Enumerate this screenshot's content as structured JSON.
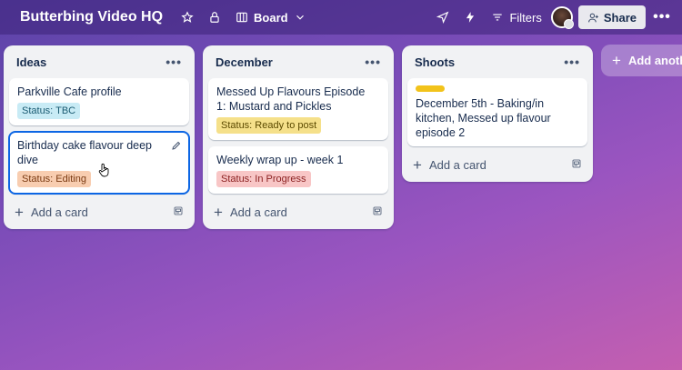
{
  "board": {
    "title": "Butterbing Video HQ",
    "view_label": "Board",
    "filters_label": "Filters",
    "share_label": "Share",
    "more_label": "•••"
  },
  "lists": [
    {
      "name": "Ideas",
      "menu": "•••",
      "add_card_label": "Add a card",
      "cards": [
        {
          "title": "Parkville Cafe profile",
          "badge": "Status: TBC",
          "badge_color": "#c8ebf5",
          "badge_text_color": "#1a5b72"
        },
        {
          "title": "Birthday cake flavour deep dive",
          "badge": "Status: Editing",
          "badge_color": "#f8cdb0",
          "badge_text_color": "#7a3a12"
        }
      ]
    },
    {
      "name": "December",
      "menu": "•••",
      "add_card_label": "Add a card",
      "cards": [
        {
          "title": "Messed Up Flavours Episode 1: Mustard and Pickles",
          "badge": "Status: Ready to post",
          "badge_color": "#f5e08a",
          "badge_text_color": "#5c4a00"
        },
        {
          "title": "Weekly wrap up - week 1",
          "badge": "Status: In Progress",
          "badge_color": "#f8c6c6",
          "badge_text_color": "#8a1f1f"
        }
      ]
    },
    {
      "name": "Shoots",
      "menu": "•••",
      "add_card_label": "Add a card",
      "cards": [
        {
          "title": "December 5th - Baking/in kitchen, Messed up flavour episode 2",
          "label_color": "#f2c31b"
        }
      ]
    }
  ],
  "add_list_label": "Add another list"
}
